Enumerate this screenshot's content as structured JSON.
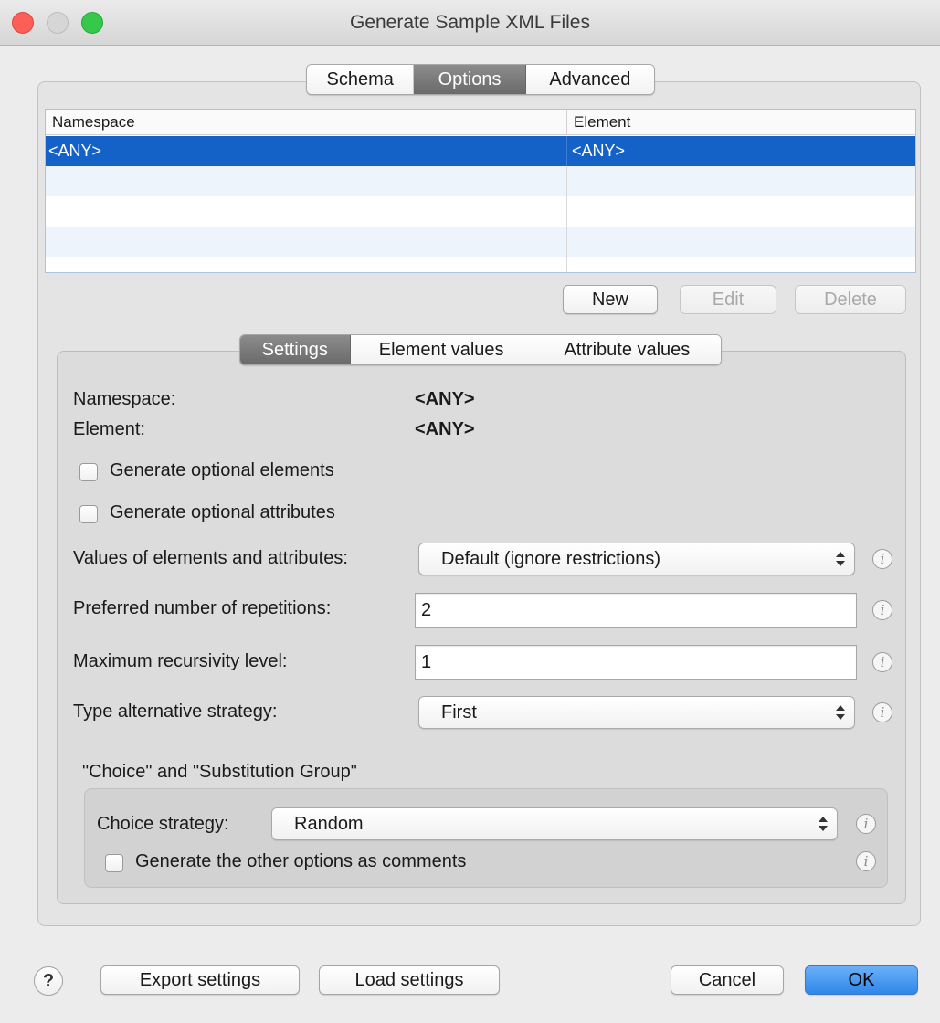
{
  "window": {
    "title": "Generate Sample XML Files"
  },
  "top_tabs": [
    {
      "label": "Schema",
      "active": false
    },
    {
      "label": "Options",
      "active": true
    },
    {
      "label": "Advanced",
      "active": false
    }
  ],
  "table": {
    "columns": [
      "Namespace",
      "Element"
    ],
    "rows": [
      {
        "namespace": "<ANY>",
        "element": "<ANY>",
        "selected": true
      }
    ]
  },
  "table_buttons": {
    "new": "New",
    "edit": "Edit",
    "delete": "Delete"
  },
  "sub_tabs": [
    {
      "label": "Settings",
      "active": true
    },
    {
      "label": "Element values",
      "active": false
    },
    {
      "label": "Attribute values",
      "active": false
    }
  ],
  "settings": {
    "namespace_label": "Namespace:",
    "namespace_value": "<ANY>",
    "element_label": "Element:",
    "element_value": "<ANY>",
    "generate_optional_elements": {
      "label": "Generate optional elements",
      "checked": false
    },
    "generate_optional_attributes": {
      "label": "Generate optional attributes",
      "checked": false
    },
    "values_label": "Values of elements and attributes:",
    "values_selected": "Default (ignore restrictions)",
    "repetitions_label": "Preferred number of repetitions:",
    "repetitions_value": "2",
    "recursivity_label": "Maximum recursivity level:",
    "recursivity_value": "1",
    "type_alt_label": "Type alternative strategy:",
    "type_alt_selected": "First",
    "group_title": "\"Choice\" and \"Substitution Group\"",
    "choice_label": "Choice strategy:",
    "choice_selected": "Random",
    "comments_option": {
      "label": "Generate the other options as comments",
      "checked": false
    },
    "info_glyph": "i"
  },
  "footer": {
    "help": "?",
    "export": "Export settings",
    "load": "Load settings",
    "cancel": "Cancel",
    "ok": "OK"
  },
  "colors": {
    "selection": "#1462c8",
    "primary_button": "#2f86ea"
  }
}
